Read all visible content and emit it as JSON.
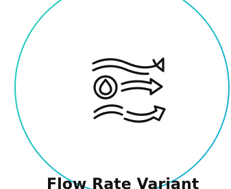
{
  "feature": {
    "title": "Flow Rate Variant",
    "icon": "flow-rate-droplet-arrows-icon",
    "ring_colors": [
      "#22d3b5",
      "#1aa8d8"
    ]
  }
}
